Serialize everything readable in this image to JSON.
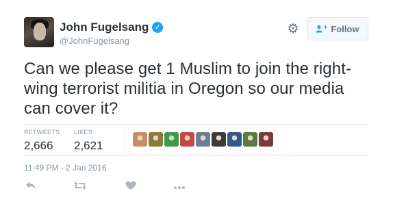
{
  "user": {
    "full_name": "John Fugelsang",
    "handle": "@JohnFugelsang",
    "verified": true
  },
  "follow_button": {
    "label": "Follow"
  },
  "tweet": {
    "text": "Can we please get 1 Muslim to join the right-wing terrorist militia in Oregon so our media can cover it?",
    "timestamp": "11:49 PM - 2 Jan 2016"
  },
  "stats": {
    "retweets_label": "RETWEETS",
    "retweets_value": "2,666",
    "likes_label": "LIKES",
    "likes_value": "2,621"
  },
  "likers": [
    {
      "color": "#c98d62"
    },
    {
      "color": "#8b7a3c"
    },
    {
      "color": "#3c9a4a"
    },
    {
      "color": "#c84646"
    },
    {
      "color": "#6b7f99"
    },
    {
      "color": "#3a3a3a"
    },
    {
      "color": "#2f5a8c"
    },
    {
      "color": "#5c7c3d"
    },
    {
      "color": "#7a3a3a"
    }
  ],
  "icons": {
    "gear": "gear-icon",
    "verified": "verified-badge-icon",
    "follow": "add-user-icon",
    "reply": "reply-icon",
    "retweet": "retweet-icon",
    "like": "heart-icon",
    "more": "more-icon"
  },
  "colors": {
    "accent": "#1da1f2",
    "text": "#292f33",
    "muted": "#8899a6",
    "icon": "#aab8c2"
  }
}
